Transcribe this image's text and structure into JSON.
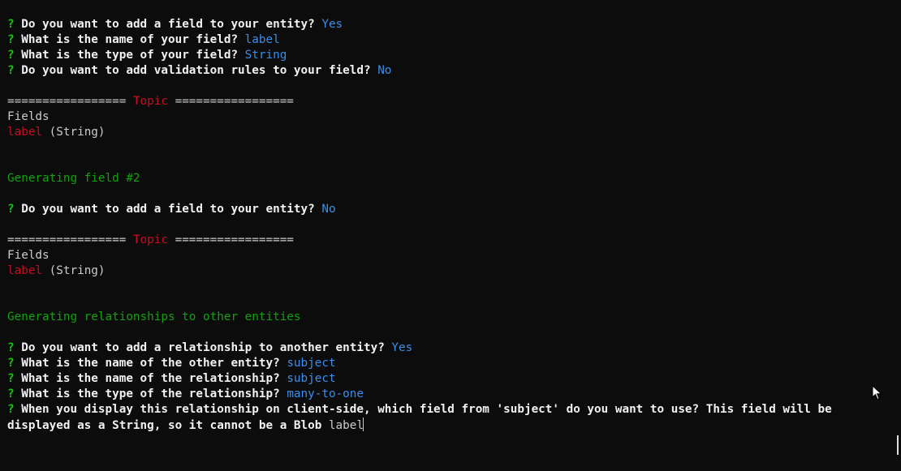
{
  "terminal": {
    "lines": {
      "l01": {
        "mark": "?",
        "prompt": "Do you want to add a field to your entity?",
        "answer": "Yes"
      },
      "l02": {
        "mark": "?",
        "prompt": "What is the name of your field?",
        "answer": "label"
      },
      "l03": {
        "mark": "?",
        "prompt": "What is the type of your field?",
        "answer": "String"
      },
      "l04": {
        "mark": "?",
        "prompt": "Do you want to add validation rules to your field?",
        "answer": "No"
      },
      "l06": {
        "rule_left": "================= ",
        "entity": "Topic",
        "rule_right": " ================="
      },
      "l07": {
        "text": "Fields"
      },
      "l08": {
        "field": "label",
        "type": " (String)"
      },
      "l11": {
        "text": "Generating field #2"
      },
      "l13": {
        "mark": "?",
        "prompt": "Do you want to add a field to your entity?",
        "answer": "No"
      },
      "l15": {
        "rule_left": "================= ",
        "entity": "Topic",
        "rule_right": " ================="
      },
      "l16": {
        "text": "Fields"
      },
      "l17": {
        "field": "label",
        "type": " (String)"
      },
      "l20": {
        "text": "Generating relationships to other entities"
      },
      "l22": {
        "mark": "?",
        "prompt": "Do you want to add a relationship to another entity?",
        "answer": "Yes"
      },
      "l23": {
        "mark": "?",
        "prompt": "What is the name of the other entity?",
        "answer": "subject"
      },
      "l24": {
        "mark": "?",
        "prompt": "What is the name of the relationship?",
        "answer": "subject"
      },
      "l25": {
        "mark": "?",
        "prompt": "What is the type of the relationship?",
        "answer": "many-to-one"
      },
      "l26": {
        "mark": "?",
        "prompt": "When you display this relationship on client-side, which field from 'subject' do you want to use? This field will be"
      },
      "l27": {
        "prompt": "displayed as a String, so it cannot be a Blob",
        "typed": "label"
      }
    }
  },
  "colors": {
    "background": "#0c0c0c",
    "question_mark": "#16c60c",
    "prompt_text": "#f2f2f2",
    "answer": "#3b8eea",
    "entity_name": "#c50f1f",
    "section_heading": "#13a10e",
    "plain_text": "#cccccc"
  },
  "icons": {
    "mouse_pointer": "mouse-pointer-icon",
    "text_cursor": "text-cursor"
  }
}
